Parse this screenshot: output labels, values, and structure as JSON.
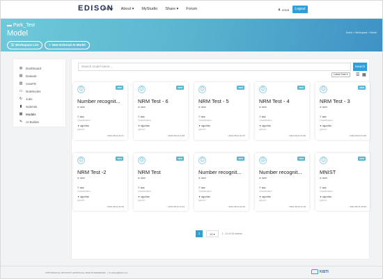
{
  "nav": {
    "logo": "EDISON",
    "items": [
      "Home",
      "About ▾",
      "MyStudio",
      "Share ▾",
      "Forum"
    ],
    "user": "emat",
    "logout_label": "Logout"
  },
  "header": {
    "project": "Park_Test",
    "title": "Model",
    "breadcrumb": "Home > Workspace > Model",
    "workspace_btn": "Workspace List",
    "new_model_btn": "New External AI Model"
  },
  "sidebar": {
    "items": [
      {
        "label": "Dashboard",
        "icon": "dashboard-icon",
        "glyph": "◍"
      },
      {
        "label": "Dataset",
        "icon": "dataset-icon",
        "glyph": "▤"
      },
      {
        "label": "AutoFE",
        "icon": "chart-icon",
        "glyph": "▥"
      },
      {
        "label": "Notebooks",
        "icon": "monitor-icon",
        "glyph": "▭"
      },
      {
        "label": "Jobs",
        "icon": "refresh-icon",
        "glyph": "↻"
      },
      {
        "label": "Submits",
        "icon": "upload-icon",
        "glyph": "▮"
      },
      {
        "label": "Models",
        "icon": "model-icon",
        "glyph": "▦"
      },
      {
        "label": "AI Builder",
        "icon": "wrench-icon",
        "glyph": "✎"
      }
    ]
  },
  "toolbar": {
    "search_placeholder": "Search model name...",
    "search_label": "Search",
    "sort_label": "Latest Date ▾"
  },
  "cards": [
    {
      "title": "Number recognit...",
      "badge": "NEW",
      "scope": "none",
      "task": "task",
      "task_value": "Classification",
      "algo": "algorithm",
      "algo_value": "pytorch",
      "date": "2021-05-24 11:47"
    },
    {
      "title": "NRM Test - 6",
      "badge": "NEW",
      "scope": "none",
      "task": "task",
      "task_value": "Classification",
      "algo": "algorithm",
      "algo_value": "pytorch",
      "date": "2021-05-24 11:38"
    },
    {
      "title": "NRM Test - 5",
      "badge": "NEW",
      "scope": "none",
      "task": "task",
      "task_value": "Classification",
      "algo": "algorithm",
      "algo_value": "pytorch",
      "date": "2021-05-24 11:37"
    },
    {
      "title": "NRM Test - 4",
      "badge": "NEW",
      "scope": "none",
      "task": "task",
      "task_value": "Classification",
      "algo": "algorithm",
      "algo_value": "pytorch",
      "date": "2021-05-24 11:36"
    },
    {
      "title": "NRM Test - 3",
      "badge": "NEW",
      "scope": "none",
      "task": "task",
      "task_value": "Classification",
      "algo": "algorithm",
      "algo_value": "pytorch",
      "date": "2021-05-24 11:35"
    },
    {
      "title": "NRM Test -2",
      "badge": "NEW",
      "scope": "none",
      "task": "task",
      "task_value": "Classification",
      "algo": "algorithm",
      "algo_value": "pytorch",
      "date": "2021-05-24 11:33"
    },
    {
      "title": "NRM Test",
      "badge": "NEW",
      "scope": "none",
      "task": "task",
      "task_value": "Classification",
      "algo": "algorithm",
      "algo_value": "pytorch",
      "date": "2021-05-24 11:31"
    },
    {
      "title": "Number recognit...",
      "badge": "NEW",
      "scope": "none",
      "task": "task",
      "task_value": "Classification",
      "algo": "algorithm",
      "algo_value": "pytorch",
      "date": "2021-05-24 11:24"
    },
    {
      "title": "Number recognit...",
      "badge": "NEW",
      "scope": "none",
      "task": "task",
      "task_value": "Classification",
      "algo": "algorithm",
      "algo_value": "pytorch",
      "date": "2021-05-24 11:19"
    },
    {
      "title": "MNIST",
      "badge": "NEW",
      "scope": "none",
      "task": "task",
      "task_value": "Classification",
      "algo": "algorithm",
      "algo_value": "pytorch",
      "date": "2021-05-21 09:40"
    }
  ],
  "pager": {
    "current": "1",
    "page_size": "10 ▾",
    "info": "1 - 10 of 10 entries"
  },
  "footer": {
    "copyright": "COPYRIGHT(C) 2015 KISTI. EDISON ALL RIGHTS RESERVED.",
    "email": "edison@kisti.re.kr",
    "logo": "KISTI"
  },
  "colors": {
    "accent": "#2f9fd8",
    "hero_start": "#6fc9da",
    "hero_end": "#3f92c5"
  }
}
